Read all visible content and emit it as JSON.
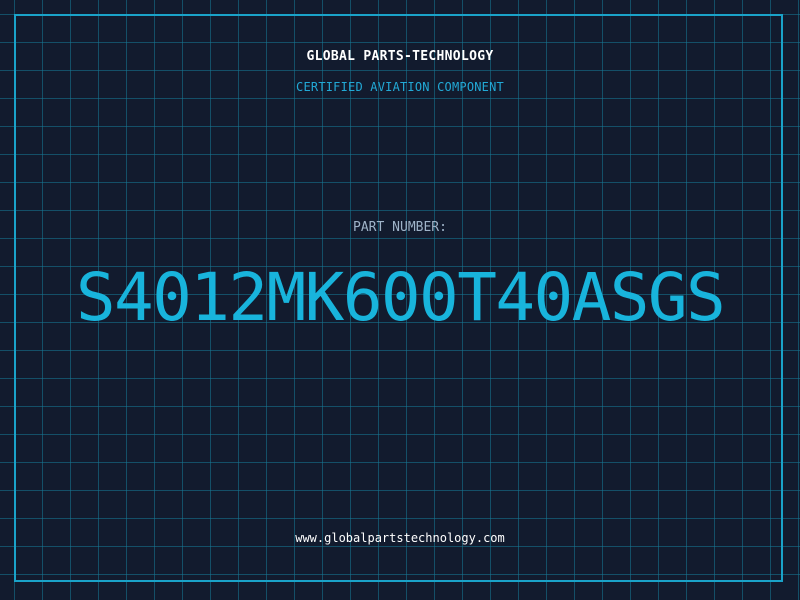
{
  "header": {
    "brand": "GLOBAL PARTS-TECHNOLOGY",
    "subtitle": "CERTIFIED AVIATION COMPONENT"
  },
  "part": {
    "label": "PART NUMBER:",
    "number": "S4012MK600T40ASGS"
  },
  "footer": {
    "url": "www.globalpartstechnology.com"
  },
  "colors": {
    "background": "#121b2e",
    "grid": "#167a96",
    "accent": "#18b4dc",
    "frame": "#1aa3c9"
  }
}
